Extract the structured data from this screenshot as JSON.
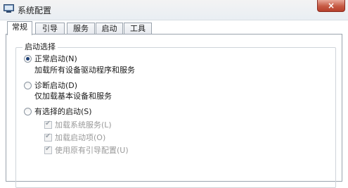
{
  "window": {
    "title": "系统配置",
    "close_label": "×"
  },
  "tabs": [
    {
      "label": "常规",
      "active": true
    },
    {
      "label": "引导",
      "active": false
    },
    {
      "label": "服务",
      "active": false
    },
    {
      "label": "启动",
      "active": false
    },
    {
      "label": "工具",
      "active": false
    }
  ],
  "startup_selection": {
    "legend": "启动选择",
    "options": [
      {
        "label": "正常启动(N)",
        "description": "加载所有设备驱动程序和服务",
        "selected": true
      },
      {
        "label": "诊断启动(D)",
        "description": "仅加载基本设备和服务",
        "selected": false
      },
      {
        "label": "有选择的启动(S)",
        "selected": false
      }
    ],
    "selective_items": [
      {
        "label": "加载系统服务(L)",
        "checked": true,
        "enabled": false
      },
      {
        "label": "加载启动项(O)",
        "checked": true,
        "enabled": false
      },
      {
        "label": "使用原有引导配置(U)",
        "checked": true,
        "enabled": false
      }
    ]
  }
}
